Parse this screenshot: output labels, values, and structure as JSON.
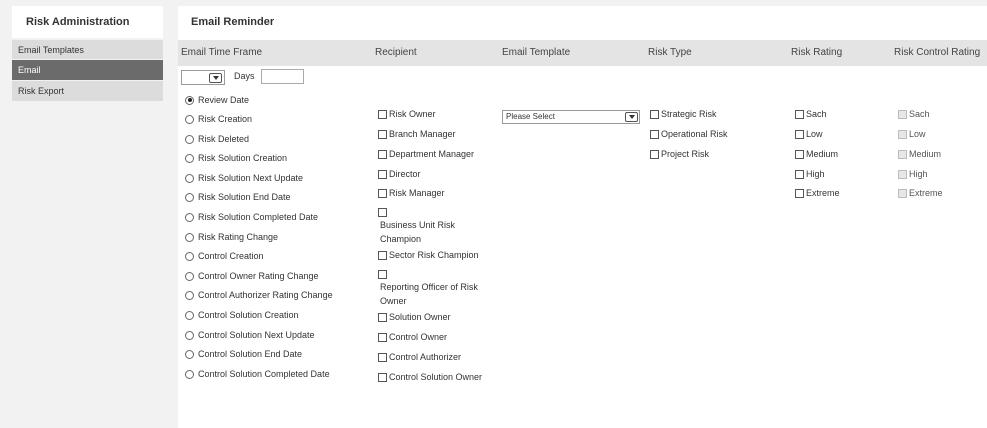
{
  "sidebar": {
    "title": "Risk Administration",
    "items": [
      {
        "label": "Email Templates"
      },
      {
        "label": "Email"
      },
      {
        "label": "Risk Export"
      }
    ]
  },
  "main": {
    "title": "Email Reminder",
    "columns": {
      "time_frame": "Email Time Frame",
      "recipient": "Recipient",
      "template": "Email Template",
      "risk_type": "Risk Type",
      "risk_rating": "Risk Rating",
      "control_rating": "Risk Control Rating"
    },
    "days_label": "Days",
    "days_value": "",
    "timeframe_value": "",
    "radios": [
      "Review Date",
      "Risk Creation",
      "Risk Deleted",
      "Risk Solution Creation",
      "Risk Solution Next Update",
      "Risk Solution End Date",
      "Risk Solution Completed Date",
      "Risk Rating Change",
      "Control Creation",
      "Control Owner Rating Change",
      "Control Authorizer Rating Change",
      "Control Solution Creation",
      "Control Solution Next Update",
      "Control Solution End Date",
      "Control Solution Completed Date"
    ],
    "recipients": [
      "Risk Owner",
      "Branch Manager",
      "Department Manager",
      "Director",
      "Risk Manager",
      "Business Unit Risk Champion",
      "Sector Risk Champion",
      "Reporting Officer of Risk Owner",
      "Solution Owner",
      "Control Owner",
      "Control Authorizer",
      "Control Solution Owner"
    ],
    "template_select": "Please Select",
    "risk_types": [
      "Strategic Risk",
      "Operational Risk",
      "Project Risk"
    ],
    "risk_ratings": [
      "Sach",
      "Low",
      "Medium",
      "High",
      "Extreme"
    ],
    "control_ratings": [
      "Sach",
      "Low",
      "Medium",
      "High",
      "Extreme"
    ]
  }
}
